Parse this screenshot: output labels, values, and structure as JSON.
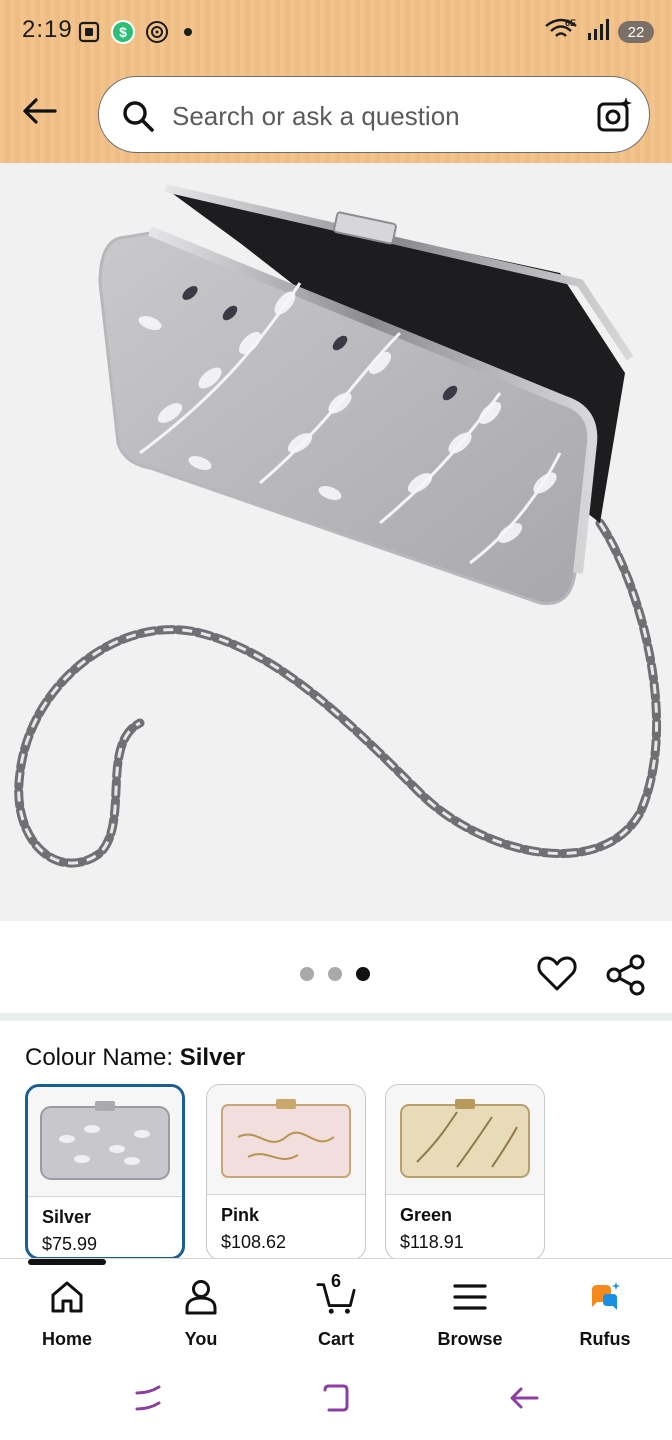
{
  "status_bar": {
    "time": "2:19",
    "network_label": "6E",
    "battery": "22"
  },
  "search": {
    "placeholder": "Search or ask a question"
  },
  "gallery": {
    "total_images": 3,
    "active_index": 2
  },
  "colour": {
    "label": "Colour Name: ",
    "selected": "Silver",
    "options": [
      {
        "name": "Silver",
        "price": "$75.99",
        "selected": true
      },
      {
        "name": "Pink",
        "price": "$108.62",
        "selected": false
      },
      {
        "name": "Green",
        "price": "$118.91",
        "selected": false
      }
    ]
  },
  "bottom_nav": {
    "home": "Home",
    "you": "You",
    "cart": "Cart",
    "cart_count": "6",
    "browse": "Browse",
    "rufus": "Rufus"
  },
  "colors": {
    "header_bg": "#f2c48c",
    "selected_border": "#1b5e91",
    "rufus_orange": "#f28a1e",
    "rufus_blue": "#1a8fe3",
    "system_nav": "#8b3fa0"
  },
  "icons": [
    "back-arrow-icon",
    "search-icon",
    "camera-icon",
    "heart-icon",
    "share-icon",
    "home-icon",
    "person-icon",
    "cart-icon",
    "menu-icon",
    "rufus-icon"
  ]
}
